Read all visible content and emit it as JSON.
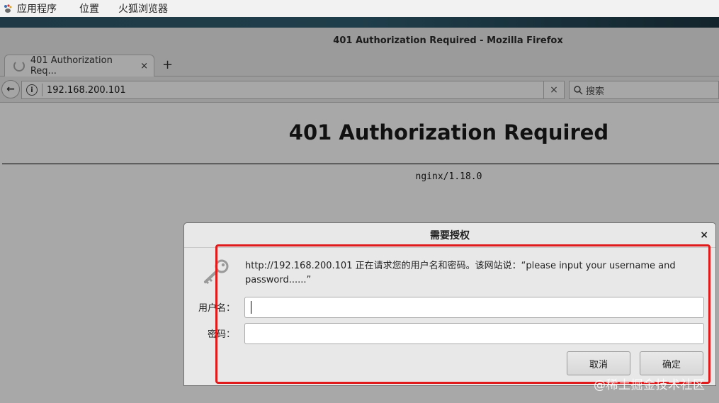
{
  "topbar": {
    "applications": "应用程序",
    "places": "位置",
    "firefox": "火狐浏览器"
  },
  "window": {
    "title": "401 Authorization Required - Mozilla Firefox"
  },
  "tabs": [
    {
      "label": "401 Authorization Req...",
      "close": "×"
    }
  ],
  "newtab": "+",
  "navbar": {
    "back": "←",
    "info": "i",
    "url": "192.168.200.101",
    "clear": "×",
    "search_icon": "magnifier-icon",
    "search_placeholder": "搜索"
  },
  "page": {
    "heading": "401 Authorization Required",
    "footer": "nginx/1.18.0"
  },
  "dialog": {
    "title": "需要授权",
    "close": "×",
    "message": "http://192.168.200.101 正在请求您的用户名和密码。该网站说：“please input your username and password......”",
    "username_label": "用户名：",
    "password_label": "密码：",
    "username_value": "",
    "password_value": "",
    "cancel": "取消",
    "ok": "确定"
  },
  "watermark": "@稀土掘金技术社区",
  "colors": {
    "annotation": "#e0191b",
    "page_bg": "#a8a8a8",
    "dialog_bg": "#e8e8e8"
  }
}
